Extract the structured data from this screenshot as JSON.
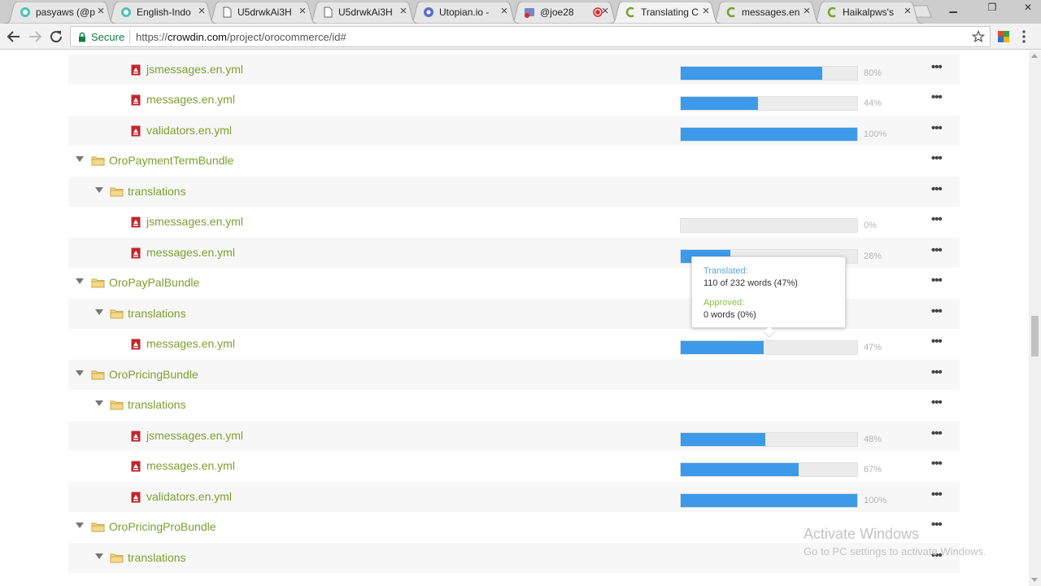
{
  "browser": {
    "tabs": [
      {
        "title": "pasyaws (@p",
        "icon": "steemit-icon",
        "active": false
      },
      {
        "title": "English-Indo",
        "icon": "steemit-icon",
        "active": false
      },
      {
        "title": "U5drwkAi3H",
        "icon": "document-icon",
        "active": false
      },
      {
        "title": "U5drwkAi3H",
        "icon": "document-icon",
        "active": false
      },
      {
        "title": "Utopian.io -",
        "icon": "utopian-icon",
        "active": false
      },
      {
        "title": "@joe28",
        "icon": "notification-icon",
        "active": false,
        "recording": true
      },
      {
        "title": "Translating C",
        "icon": "crowdin-icon",
        "active": true
      },
      {
        "title": "messages.en",
        "icon": "crowdin-icon",
        "active": false
      },
      {
        "title": "Haikalpws's",
        "icon": "crowdin-icon",
        "active": false
      }
    ],
    "tab_close_glyph": "×",
    "secure_label": "Secure",
    "url_scheme": "https://",
    "url_host": "crowdin.com",
    "url_path": "/project/orocommerce/id#"
  },
  "files": {
    "rows": [
      {
        "kind": "file",
        "name": "jsmessages.en.yml",
        "progress": "80%"
      },
      {
        "kind": "file",
        "name": "messages.en.yml",
        "progress": "44%"
      },
      {
        "kind": "file",
        "name": "validators.en.yml",
        "progress": "100%"
      },
      {
        "kind": "folder",
        "name": "OroPaymentTermBundle"
      },
      {
        "kind": "folder",
        "name": "translations"
      },
      {
        "kind": "file",
        "name": "jsmessages.en.yml",
        "progress": "0%"
      },
      {
        "kind": "file",
        "name": "messages.en.yml",
        "progress": "28%"
      },
      {
        "kind": "folder",
        "name": "OroPayPalBundle"
      },
      {
        "kind": "folder",
        "name": "translations"
      },
      {
        "kind": "file",
        "name": "messages.en.yml",
        "progress": "47%"
      },
      {
        "kind": "folder",
        "name": "OroPricingBundle"
      },
      {
        "kind": "folder",
        "name": "translations"
      },
      {
        "kind": "file",
        "name": "jsmessages.en.yml",
        "progress": "48%"
      },
      {
        "kind": "file",
        "name": "messages.en.yml",
        "progress": "67%"
      },
      {
        "kind": "file",
        "name": "validators.en.yml",
        "progress": "100%"
      },
      {
        "kind": "folder",
        "name": "OroPricingProBundle"
      },
      {
        "kind": "folder",
        "name": "translations"
      }
    ],
    "more_glyph": "•••"
  },
  "tooltip": {
    "translated_label": "Translated:",
    "translated_value": "110 of 232 words (47%)",
    "approved_label": "Approved:",
    "approved_value": "0 words (0%)"
  },
  "watermark": {
    "title": "Activate Windows",
    "subtitle": "Go to PC settings to activate Windows."
  },
  "colors": {
    "accent_green": "#7b9f2e",
    "progress_blue": "#3d9ae8",
    "tooltip_blue": "#5aa4d9",
    "tooltip_green": "#8cc04b",
    "secure_green": "#0b8043"
  }
}
